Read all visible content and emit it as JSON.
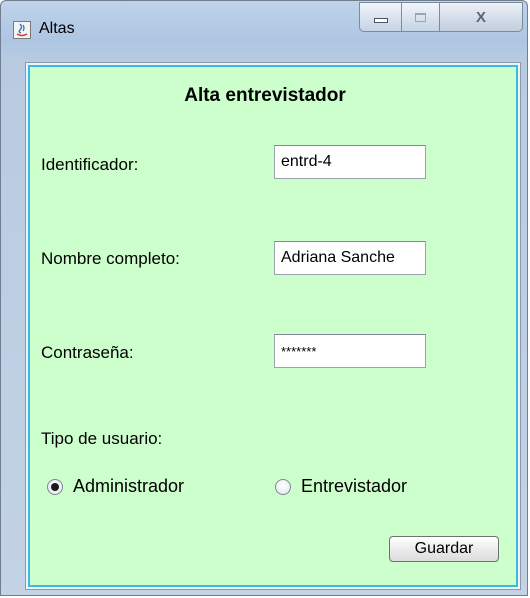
{
  "window": {
    "title": "Altas",
    "controls": {
      "minimize_icon": "minimize-icon",
      "maximize_icon": "maximize-icon",
      "close_icon": "close-icon"
    }
  },
  "form": {
    "heading": "Alta entrevistador",
    "fields": [
      {
        "label": "Identificador:",
        "value": "entrd-4"
      },
      {
        "label": "Nombre completo:",
        "value": "Adriana Sanche"
      },
      {
        "label": "Contraseña:",
        "value": "*******"
      }
    ],
    "user_type_label": "Tipo de usuario:",
    "user_types": [
      {
        "label": "Administrador",
        "selected": true
      },
      {
        "label": "Entrevistador",
        "selected": false
      }
    ],
    "save_label": "Guardar"
  },
  "colors": {
    "panel_background": "#ccffcc",
    "panel_border": "#3cb9e0"
  }
}
